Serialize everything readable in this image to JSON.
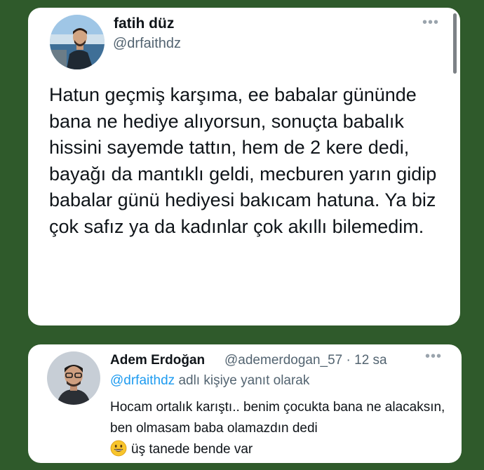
{
  "tweet": {
    "display_name": "fatih düz",
    "handle": "@drfaithdz",
    "more_icon": "more-horizontal-icon",
    "text": "Hatun geçmiş karşıma, ee babalar gününde bana ne hediye alıyorsun, sonuçta babalık hissini sayemde tattın, hem de 2 kere dedi, bayağı da mantıklı geldi, mecburen yarın gidip babalar günü hediyesi bakıcam hatuna. Ya biz çok safız ya da kadınlar çok akıllı bilemedim."
  },
  "reply": {
    "display_name": "Adem Erdoğan",
    "meta": "@ademerdogan_57 · 12 sa",
    "replying_mention": "@drfaithdz",
    "replying_suffix": "adlı kişiye yanıt olarak",
    "text_main": "Hocam ortalık karıştı.. benim çocukta bana ne alacaksın, ben olmasam baba olamazdın dedi",
    "emoji_icon": "grinning-face-emoji",
    "text_tail": "üş tanede bende var"
  },
  "colors": {
    "background": "#2f5a2b",
    "card": "#ffffff",
    "text": "#0f1419",
    "muted": "#536471",
    "link": "#1d9bf0"
  }
}
